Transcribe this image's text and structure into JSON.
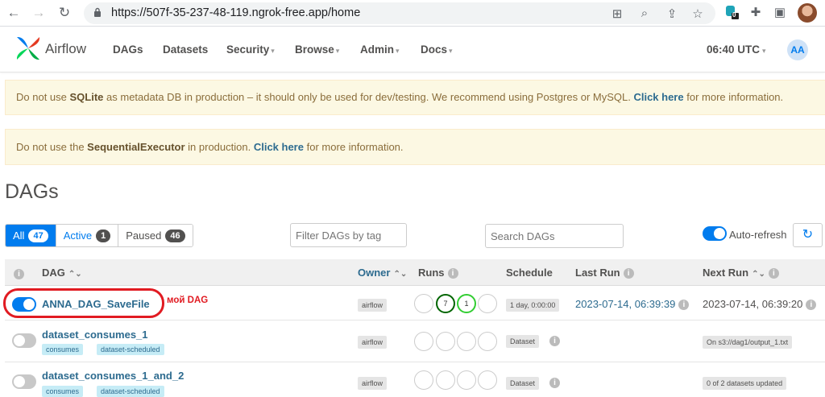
{
  "browser": {
    "url": "https://507f-35-237-48-119.ngrok-free.app/home",
    "extension_badge": "0"
  },
  "navbar": {
    "brand": "Airflow",
    "menu": [
      {
        "label": "DAGs",
        "dropdown": false
      },
      {
        "label": "Datasets",
        "dropdown": false
      },
      {
        "label": "Security",
        "dropdown": true
      },
      {
        "label": "Browse",
        "dropdown": true
      },
      {
        "label": "Admin",
        "dropdown": true
      },
      {
        "label": "Docs",
        "dropdown": true
      }
    ],
    "clock": "06:40 UTC",
    "user_initials": "AA"
  },
  "alerts": [
    {
      "pre": "Do not use ",
      "bold": "SQLite",
      "mid": " as metadata DB in production – it should only be used for dev/testing. We recommend using Postgres or MySQL. ",
      "link": "Click here",
      "post": " for more information."
    },
    {
      "pre": "Do not use the ",
      "bold": "SequentialExecutor",
      "mid": " in production. ",
      "link": "Click here",
      "post": " for more information."
    }
  ],
  "page": {
    "title": "DAGs",
    "filters": {
      "all_label": "All",
      "all_count": "47",
      "active_label": "Active",
      "active_count": "1",
      "paused_label": "Paused",
      "paused_count": "46"
    },
    "tag_filter_placeholder": "Filter DAGs by tag",
    "search_placeholder": "Search DAGs",
    "autorefresh_label": "Auto-refresh",
    "autorefresh_on": true
  },
  "table": {
    "headers": {
      "dag": "DAG",
      "owner": "Owner",
      "runs": "Runs",
      "schedule": "Schedule",
      "last_run": "Last Run",
      "next_run": "Next Run"
    },
    "rows": [
      {
        "name": "ANNA_DAG_SaveFile",
        "enabled": true,
        "tags": [],
        "owner": "airflow",
        "runs": [
          {
            "label": "",
            "state": "none"
          },
          {
            "label": "7",
            "state": "success"
          },
          {
            "label": "1",
            "state": "running"
          },
          {
            "label": "",
            "state": "none"
          }
        ],
        "schedule": "1 day, 0:00:00",
        "last_run": "2023-07-14, 06:39:39",
        "next_run": "2023-07-14, 06:39:20"
      },
      {
        "name": "dataset_consumes_1",
        "enabled": false,
        "tags": [
          "consumes",
          "dataset-scheduled"
        ],
        "owner": "airflow",
        "runs": [
          {
            "label": "",
            "state": "none"
          },
          {
            "label": "",
            "state": "none"
          },
          {
            "label": "",
            "state": "none"
          },
          {
            "label": "",
            "state": "none"
          }
        ],
        "schedule": "Dataset",
        "last_run": "",
        "next_run": "On s3://dag1/output_1.txt"
      },
      {
        "name": "dataset_consumes_1_and_2",
        "enabled": false,
        "tags": [
          "consumes",
          "dataset-scheduled"
        ],
        "owner": "airflow",
        "runs": [
          {
            "label": "",
            "state": "none"
          },
          {
            "label": "",
            "state": "none"
          },
          {
            "label": "",
            "state": "none"
          },
          {
            "label": "",
            "state": "none"
          }
        ],
        "schedule": "Dataset",
        "last_run": "",
        "next_run": "0 of 2 datasets updated"
      }
    ]
  },
  "annotation": {
    "text": "мой DAG",
    "color": "#e11b22"
  },
  "colors": {
    "accent": "#017cee",
    "link": "#2d6b8f",
    "success": "#006400",
    "running": "#32cd32",
    "warning_bg": "#fcf8e3"
  }
}
